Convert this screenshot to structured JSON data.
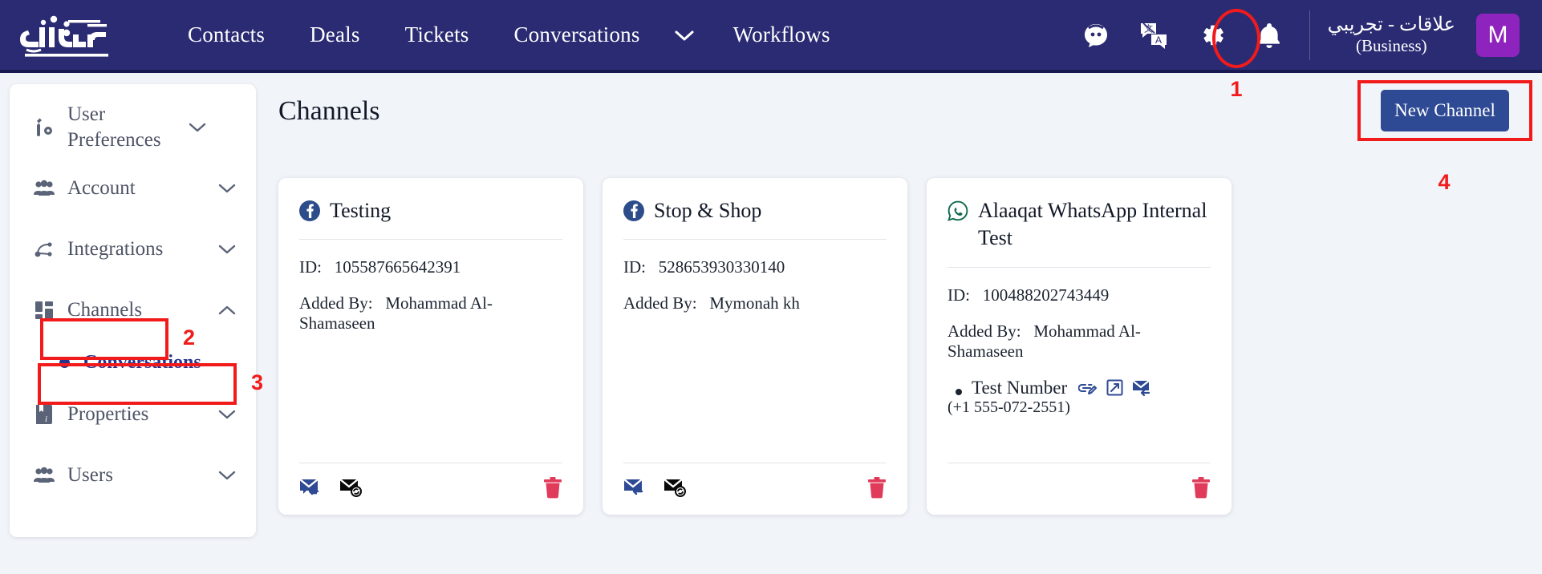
{
  "topnav": {
    "logo_alt": "alaaqat-logo",
    "items": [
      {
        "label": "Contacts"
      },
      {
        "label": "Deals"
      },
      {
        "label": "Tickets"
      },
      {
        "label": "Conversations"
      },
      {
        "label": "Workflows"
      }
    ],
    "icons": [
      {
        "name": "chat-bot-icon"
      },
      {
        "name": "translate-icon"
      },
      {
        "name": "gear-icon"
      },
      {
        "name": "bell-icon"
      }
    ],
    "org_name": "علاقات - تجريبي",
    "org_type": "(Business)",
    "avatar_initial": "M"
  },
  "annotations": {
    "one": "1",
    "two": "2",
    "three": "3",
    "four": "4",
    "color": "#f21b1b"
  },
  "sidebar": {
    "items": [
      {
        "label": "User Preferences",
        "icon": "wrench-gear-icon",
        "chevron": "down",
        "expanded": false
      },
      {
        "label": "Account",
        "icon": "people-icon",
        "chevron": "down",
        "expanded": false
      },
      {
        "label": "Integrations",
        "icon": "nodes-icon",
        "chevron": "down",
        "expanded": false
      },
      {
        "label": "Channels",
        "icon": "grid-icon",
        "chevron": "up",
        "expanded": true
      },
      {
        "label": "Properties",
        "icon": "book-info-icon",
        "chevron": "down",
        "expanded": false
      },
      {
        "label": "Users",
        "icon": "people-icon",
        "chevron": "down",
        "expanded": false
      }
    ],
    "sub_items": [
      {
        "label": "Conversations",
        "parent": "Channels",
        "active": true
      }
    ]
  },
  "main": {
    "title": "Channels",
    "new_channel_label": "New Channel",
    "cards": [
      {
        "platform": "facebook",
        "name": "Testing",
        "id_label": "ID:",
        "id_value": "105587665642391",
        "added_label": "Added By:",
        "added_value": "Mohammad Al-Shamaseen",
        "phone": null,
        "actions": [
          "mail-reply-icon",
          "mail-sync-icon",
          "trash-icon"
        ]
      },
      {
        "platform": "facebook",
        "name": "Stop & Shop",
        "id_label": "ID:",
        "id_value": "528653930330140",
        "added_label": "Added By:",
        "added_value": "Mymonah kh",
        "phone": null,
        "actions": [
          "mail-reply-icon",
          "mail-sync-icon",
          "trash-icon"
        ]
      },
      {
        "platform": "whatsapp",
        "name": "Alaaqat WhatsApp Internal Test",
        "id_label": "ID:",
        "id_value": "100488202743449",
        "added_label": "Added By:",
        "added_value": "Mohammad Al-Shamaseen",
        "phone": {
          "name": "Test Number",
          "number": "(+1 555-072-2551)",
          "icons": [
            "link-edit-icon",
            "edit-square-icon",
            "mail-reply-icon"
          ]
        },
        "actions": [
          "trash-icon"
        ]
      }
    ]
  },
  "colors": {
    "nav_bg": "#2b2b74",
    "page_bg": "#f1f4f8",
    "primary_btn": "#2e4a94",
    "accent_red": "#f21b1b",
    "trash_red": "#e03b5a",
    "avatar_purple": "#8e24bd",
    "facebook_blue": "#2d4c8a",
    "whatsapp_green": "#0d6b4f",
    "active_blue": "#27348b"
  }
}
